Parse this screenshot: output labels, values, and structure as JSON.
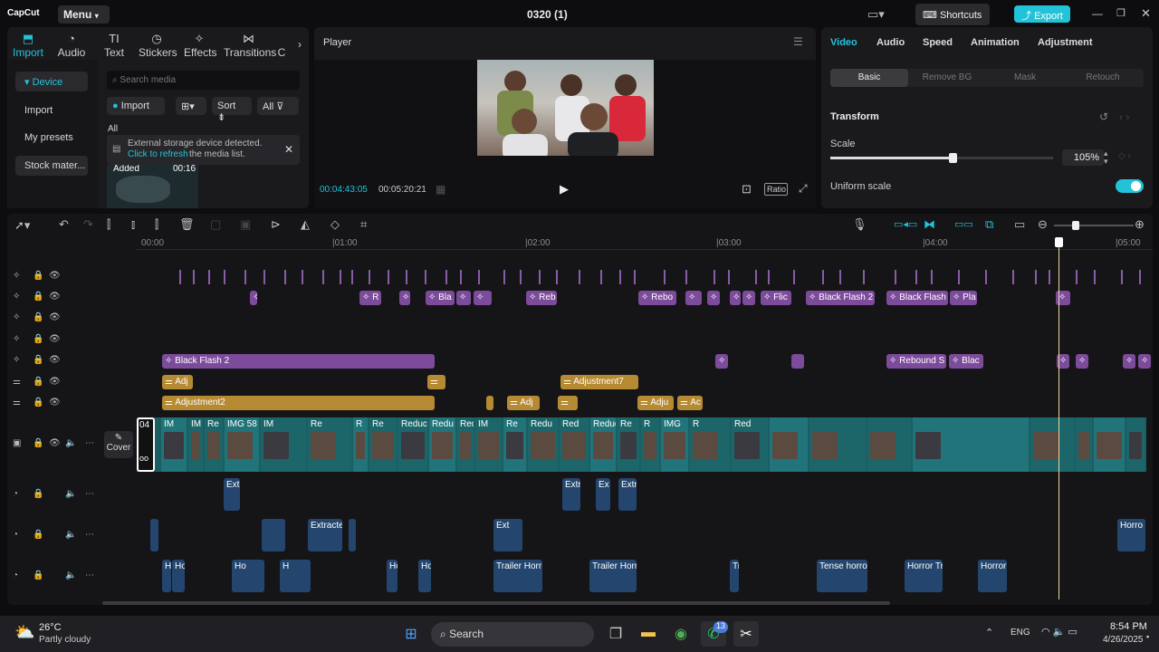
{
  "titlebar": {
    "app": "CapCut",
    "menu": "Menu",
    "project": "0320 (1)",
    "shortcuts": "Shortcuts",
    "export": "Export"
  },
  "media_tabs": [
    "Import",
    "Audio",
    "Text",
    "Stickers",
    "Effects",
    "Transitions",
    "C"
  ],
  "sidebar": {
    "items": [
      "Device",
      "Import",
      "My presets",
      "Stock mater..."
    ]
  },
  "media": {
    "search_placeholder": "Search media",
    "import": "Import",
    "sort": "Sort",
    "all_filter": "All",
    "section": "All",
    "notice_line1": "External storage device detected.",
    "notice_link": "Click to refresh",
    "notice_rest": "the media list.",
    "added": "Added",
    "duration": "00:16"
  },
  "player": {
    "title": "Player",
    "current": "00:04:43:05",
    "total": "00:05:20:21",
    "ratio": "Ratio"
  },
  "props": {
    "tabs": [
      "Video",
      "Audio",
      "Speed",
      "Animation",
      "Adjustment"
    ],
    "subtabs": [
      "Basic",
      "Remove BG",
      "Mask",
      "Retouch"
    ],
    "transform": "Transform",
    "scale_label": "Scale",
    "scale_value": "105%",
    "scale_fraction": 0.55,
    "uniform_scale": "Uniform scale"
  },
  "timeline": {
    "ruler": [
      "00:00",
      "|01:00",
      "|02:00",
      "|03:00",
      "|04:00",
      "|05:00"
    ],
    "cover": "Cover",
    "fx_row2": [
      "R",
      "Bla",
      "Reb",
      "Rebo",
      "Flic",
      "Black Flash 2",
      "Black Flash",
      "Pla"
    ],
    "fx_row5": [
      "Black Flash 2",
      "Rebound S",
      "Blac"
    ],
    "adj_row1": [
      "Adj",
      "Adjustment7"
    ],
    "adj_row2": [
      "Adjustment2",
      "Adj",
      "Adju",
      "Ac"
    ],
    "video_labels": [
      "04",
      "IM",
      "IM",
      "Re",
      "IMG 58",
      "IM",
      "Re",
      "R",
      "Re",
      "Reduce",
      "Redu",
      "Red",
      "IM",
      "Re",
      "Redu",
      "Red",
      "Reduce",
      "Re",
      "R",
      "IMG",
      "R",
      "Red"
    ],
    "audio1": [
      "Extr",
      "Extra",
      "Ex",
      "Extr"
    ],
    "audio2": [
      "Extracte",
      "Ext",
      "Horro"
    ],
    "audio3": [
      "H",
      "Ho",
      "Ho",
      "H",
      "Ho",
      "Ho",
      "Trailer Horr",
      "Trailer Horr",
      "Tr",
      "Tense horror",
      "Horror Tr",
      "Horror"
    ]
  },
  "taskbar": {
    "temp": "26°C",
    "weather": "Partly cloudy",
    "search": "Search",
    "lang": "ENG",
    "time": "8:54 PM",
    "date": "4/26/2025",
    "badge": "13"
  },
  "colors": {
    "accent": "#22c3d8",
    "purple": "#7d4b9b",
    "gold": "#b58a32",
    "video": "#1f6f73",
    "audio": "#24466e"
  }
}
